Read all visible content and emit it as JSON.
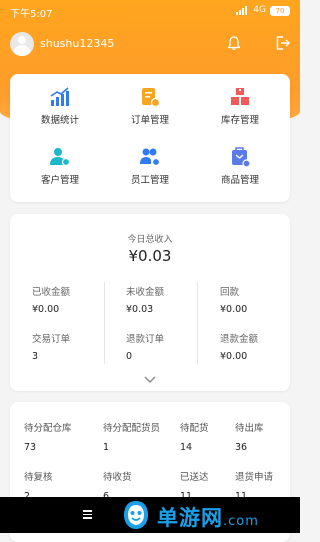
{
  "status_bar": {
    "time": "下午5:07",
    "network": "4G",
    "battery": "70"
  },
  "header": {
    "username": "shushu12345",
    "bell_icon": "bell-icon",
    "logout_icon": "logout-icon"
  },
  "menu": [
    {
      "label": "数据统计",
      "icon": "chart-icon",
      "color": "#2f7bef"
    },
    {
      "label": "订单管理",
      "icon": "order-icon",
      "color": "#f6a623"
    },
    {
      "label": "库存管理",
      "icon": "inventory-icon",
      "color": "#f05a5a"
    },
    {
      "label": "客户管理",
      "icon": "customer-icon",
      "color": "#1cb7c9"
    },
    {
      "label": "员工管理",
      "icon": "staff-icon",
      "color": "#2f7bef"
    },
    {
      "label": "商品管理",
      "icon": "product-icon",
      "color": "#5b7be8"
    }
  ],
  "income": {
    "title": "今日总收入",
    "total": "¥0.03",
    "stats": [
      {
        "label": "已收金额",
        "value": "¥0.00"
      },
      {
        "label": "未收金额",
        "value": "¥0.03"
      },
      {
        "label": "回款",
        "value": "¥0.00"
      },
      {
        "label": "交易订单",
        "value": "3"
      },
      {
        "label": "退款订单",
        "value": "0"
      },
      {
        "label": "退款金额",
        "value": "¥0.00"
      }
    ],
    "expand_icon": "chevron-down-icon"
  },
  "orders": [
    {
      "label": "待分配仓库",
      "value": "73"
    },
    {
      "label": "待分配配货员",
      "value": "1"
    },
    {
      "label": "待配货",
      "value": "14"
    },
    {
      "label": "待出库",
      "value": "36"
    },
    {
      "label": "待复核",
      "value": "2"
    },
    {
      "label": "待收货",
      "value": "6"
    },
    {
      "label": "已送达",
      "value": "11"
    },
    {
      "label": "退货申请",
      "value": "11"
    }
  ],
  "watermark": {
    "text": "单游网",
    "tld": ".com",
    "color": "#1aa0e8"
  },
  "colors": {
    "brand": "#ff9d2a",
    "accent_blue": "#2f7bef"
  }
}
